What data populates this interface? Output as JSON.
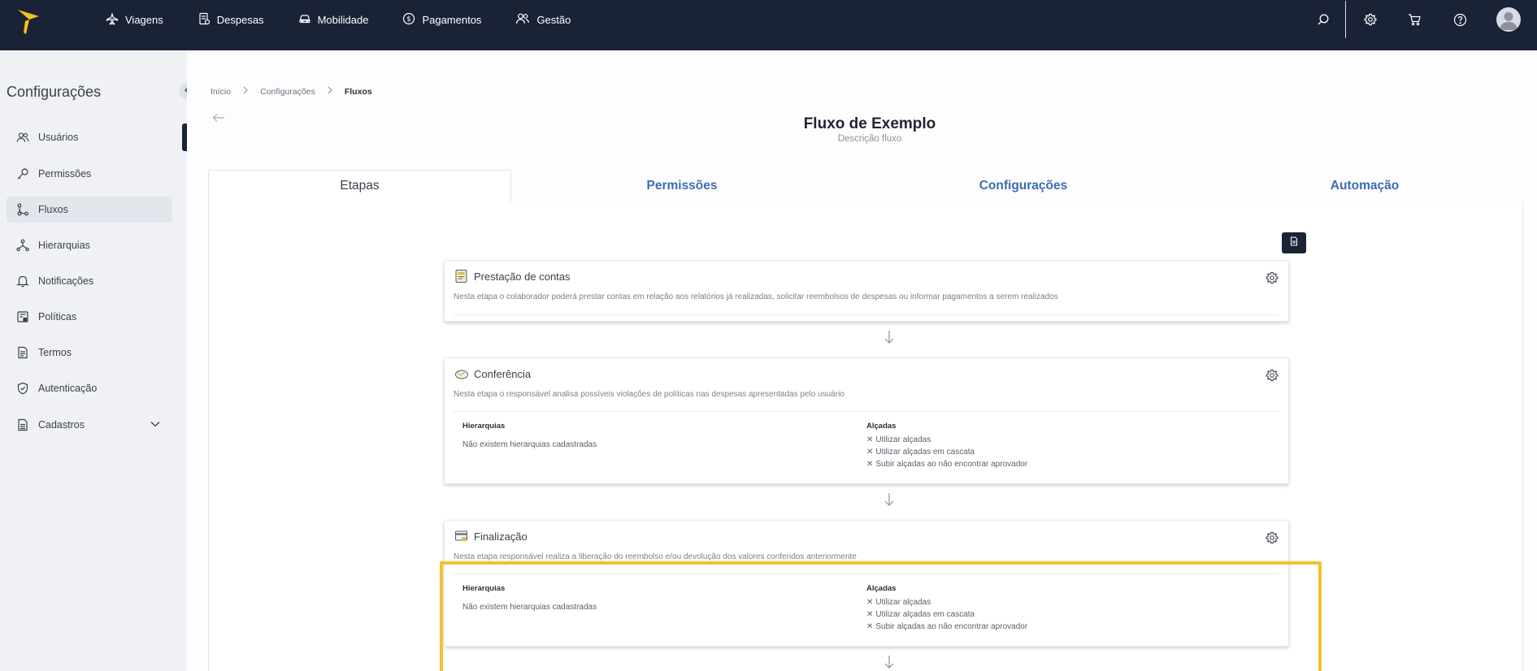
{
  "topbar": {
    "nav": [
      {
        "label": "Viagens",
        "icon": "airplane-icon"
      },
      {
        "label": "Despesas",
        "icon": "receipt-icon"
      },
      {
        "label": "Mobilidade",
        "icon": "car-icon"
      },
      {
        "label": "Pagamentos",
        "icon": "dollar-coin-icon"
      },
      {
        "label": "Gestão",
        "icon": "users-icon"
      }
    ],
    "right_icons": [
      "search-icon",
      "gear-icon",
      "cart-icon",
      "help-icon",
      "user-avatar"
    ]
  },
  "sidebar": {
    "title": "Configurações",
    "items": [
      {
        "label": "Usuários",
        "icon": "users-icon"
      },
      {
        "label": "Permissões",
        "icon": "key-icon"
      },
      {
        "label": "Fluxos",
        "icon": "flow-icon",
        "active": true
      },
      {
        "label": "Hierarquias",
        "icon": "hierarchy-icon"
      },
      {
        "label": "Notificações",
        "icon": "bell-icon"
      },
      {
        "label": "Políticas",
        "icon": "policy-icon"
      },
      {
        "label": "Termos",
        "icon": "terms-icon"
      },
      {
        "label": "Autenticação",
        "icon": "shield-icon"
      },
      {
        "label": "Cadastros",
        "icon": "document-icon",
        "expandable": true
      }
    ]
  },
  "breadcrumb": [
    "Início",
    "Configurações",
    "Fluxos"
  ],
  "page": {
    "title": "Fluxo de Exemplo",
    "description": "Descrição fluxo"
  },
  "tabs": [
    {
      "label": "Etapas",
      "active": true
    },
    {
      "label": "Permissões"
    },
    {
      "label": "Configurações"
    },
    {
      "label": "Automação"
    }
  ],
  "steps": [
    {
      "title": "Prestação de contas",
      "description": "Nesta etapa o colaborador poderá prestar contas em relação aos relatórios já realizadas, solicitar reembolsos de despesas ou informar pagamentos a serem realizados"
    },
    {
      "title": "Conferência",
      "description": "Nesta etapa o responsável analisa possíveis violações de políticas nas despesas apresentadas pelo usuário",
      "hierarchies_title": "Hierarquias",
      "hierarchies_text": "Não existem hierarquias cadastradas",
      "alcadas_title": "Alçadas",
      "alcadas": [
        "Utilizar alçadas",
        "Utilizar alçadas em cascata",
        "Subir alçadas ao não encontrar aprovador"
      ]
    },
    {
      "title": "Finalização",
      "description": "Nesta etapa responsável realiza a liberação do reembolso e/ou devolução dos valores conferidos anteriormente",
      "hierarchies_title": "Hierarquias",
      "hierarchies_text": "Não existem hierarquias cadastradas",
      "alcadas_title": "Alçadas",
      "alcadas": [
        "Utilizar alçadas",
        "Utilizar alçadas em cascata",
        "Subir alçadas ao não encontrar aprovador"
      ],
      "highlighted": true
    }
  ],
  "colors": {
    "topbar": "#1a2236",
    "tab_link": "#3b6db3",
    "highlight": "#f5c02e",
    "logo": "#f7c21a"
  }
}
